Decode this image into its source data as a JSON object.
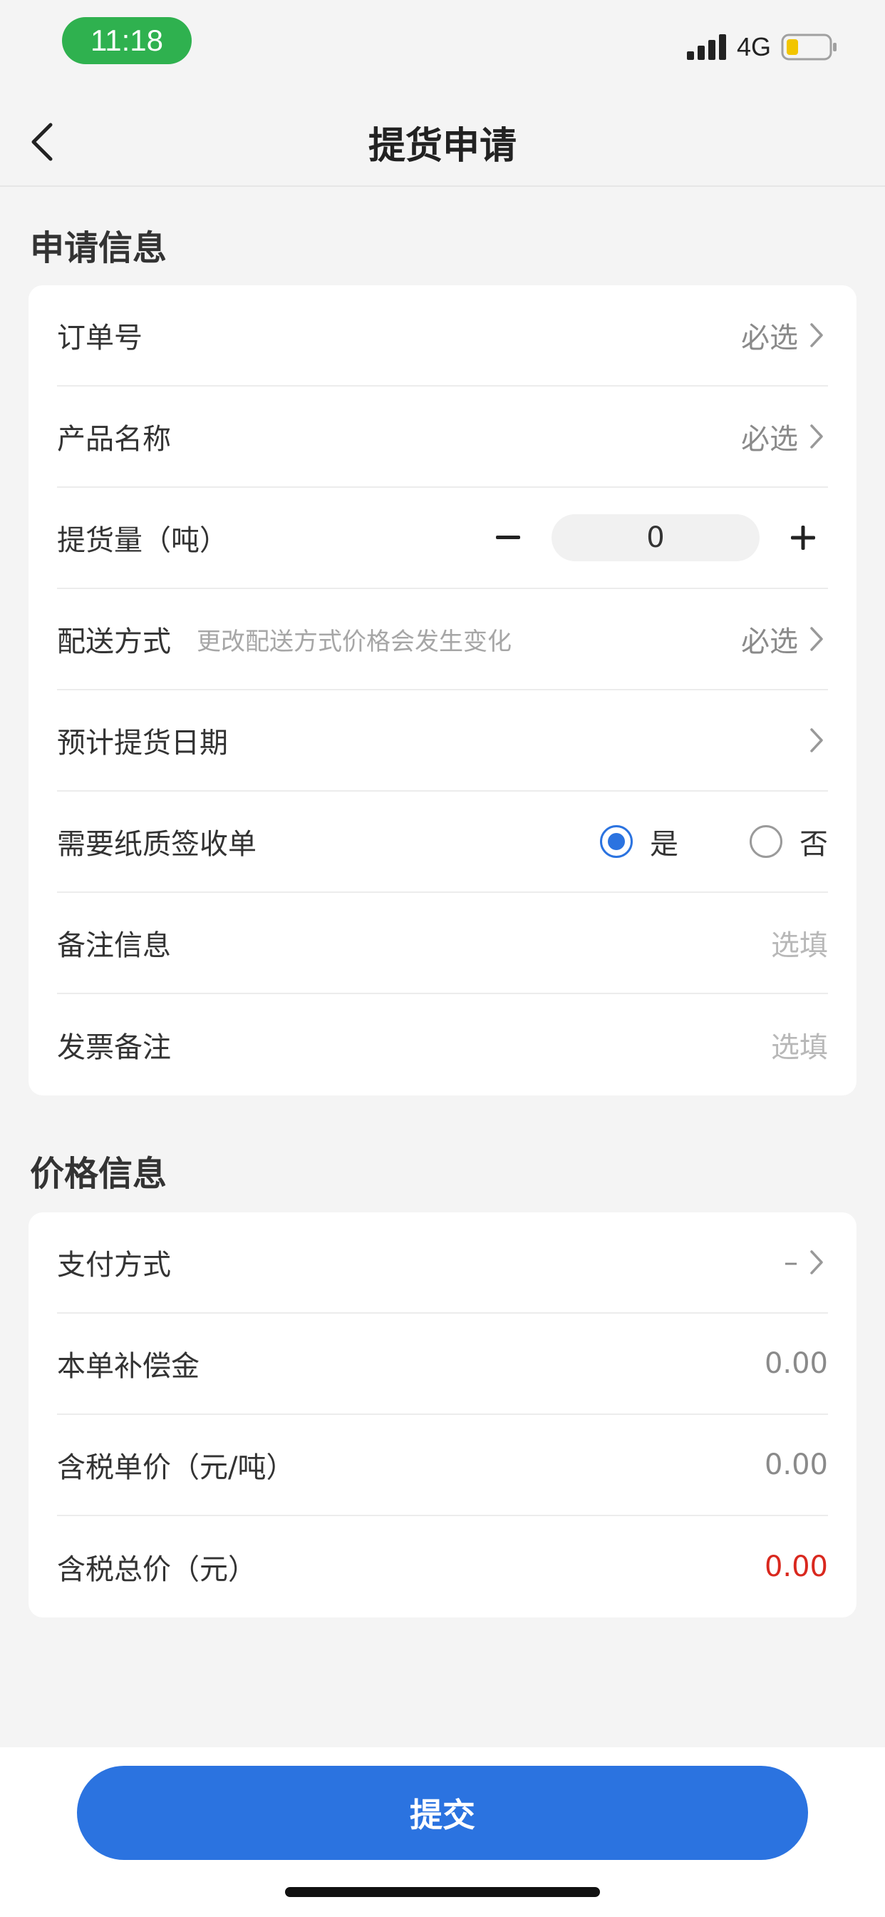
{
  "status_bar": {
    "time": "11:18",
    "network": "4G"
  },
  "nav": {
    "title": "提货申请",
    "back_icon": "chevron-left-icon"
  },
  "apply_section": {
    "title": "申请信息",
    "order_no": {
      "label": "订单号",
      "value": "必选"
    },
    "product_name": {
      "label": "产品名称",
      "value": "必选"
    },
    "quantity": {
      "label": "提货量（吨）",
      "value": "0",
      "minus": "−",
      "plus": "+"
    },
    "delivery": {
      "label": "配送方式",
      "hint": "更改配送方式价格会发生变化",
      "value": "必选"
    },
    "pickup_date": {
      "label": "预计提货日期"
    },
    "paper_receipt": {
      "label": "需要纸质签收单",
      "yes": "是",
      "no": "否",
      "selected": "是"
    },
    "remark": {
      "label": "备注信息",
      "placeholder": "选填"
    },
    "invoice_remark": {
      "label": "发票备注",
      "placeholder": "选填"
    }
  },
  "price_section": {
    "title": "价格信息",
    "payment": {
      "label": "支付方式",
      "value": "–"
    },
    "compensation": {
      "label": "本单补偿金",
      "value": "0.00"
    },
    "unit_price": {
      "label": "含税单价（元/吨）",
      "value": "0.00"
    },
    "total_price": {
      "label": "含税总价（元）",
      "value": "0.00"
    }
  },
  "submit": {
    "label": "提交"
  },
  "colors": {
    "primary": "#2b73e0",
    "status_green": "#2fb14f",
    "price_red": "#d9281e",
    "background": "#f4f4f4"
  }
}
